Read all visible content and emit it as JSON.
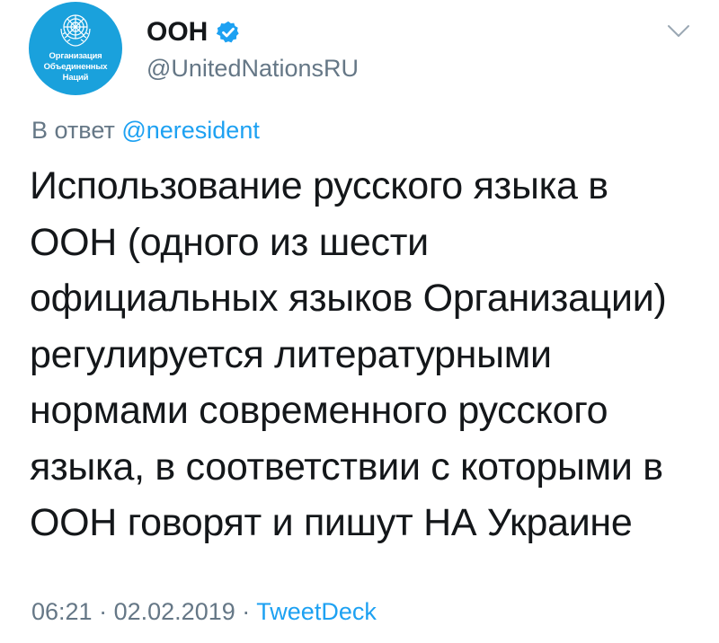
{
  "author": {
    "display_name": "ООН",
    "handle": "@UnitedNationsRU",
    "verified": true,
    "avatar_text": [
      "Организация",
      "Объединенных",
      "Наций"
    ],
    "avatar_color": "#1aa1dc"
  },
  "reply": {
    "prefix": "В ответ",
    "mention": "@neresident"
  },
  "tweet": {
    "lines": [
      "Использование русского языка в",
      "ООН (одного из шести",
      "официальных языков Организации)",
      "регулируется литературными",
      "нормами современного русского",
      "языка, в соответствии с которыми в",
      "ООН говорят и пишут НА Украине"
    ]
  },
  "meta": {
    "time": "06:21",
    "separator": "·",
    "date": "02.02.2019",
    "source": "TweetDeck"
  },
  "colors": {
    "text": "#14171a",
    "secondary": "#657786",
    "link": "#1da1f2",
    "verified_badge": "#1da1f2"
  },
  "icons": {
    "verified": "verified-badge-icon",
    "menu": "chevron-down-icon",
    "emblem": "un-emblem-icon"
  }
}
